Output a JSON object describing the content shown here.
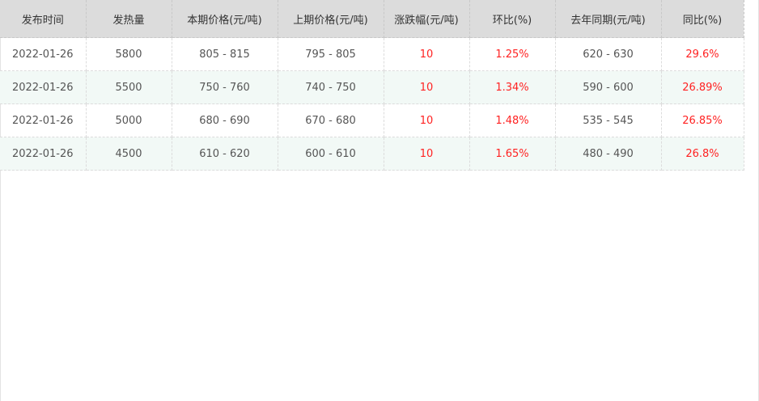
{
  "table": {
    "headers": [
      "发布时间",
      "发热量",
      "本期价格(元/吨)",
      "上期价格(元/吨)",
      "涨跌幅(元/吨)",
      "环比(%)",
      "去年同期(元/吨)",
      "同比(%)"
    ],
    "rows": [
      [
        "2022-01-26",
        "5800",
        "805 - 815",
        "795 - 805",
        "10",
        "1.25%",
        "620 - 630",
        "29.6%"
      ],
      [
        "2022-01-26",
        "5500",
        "750 - 760",
        "740 - 750",
        "10",
        "1.34%",
        "590 - 600",
        "26.89%"
      ],
      [
        "2022-01-26",
        "5000",
        "680 - 690",
        "670 - 680",
        "10",
        "1.48%",
        "535 - 545",
        "26.85%"
      ],
      [
        "2022-01-26",
        "4500",
        "610 - 620",
        "600 - 610",
        "10",
        "1.65%",
        "480 - 490",
        "26.8%"
      ]
    ]
  },
  "colors": {
    "header_bg": "#dcdcdc",
    "alt_row_bg": "#f2f9f6",
    "increase_text": "#ff2222",
    "body_text": "#555555"
  }
}
